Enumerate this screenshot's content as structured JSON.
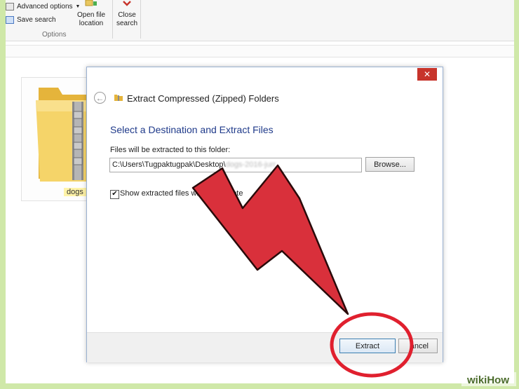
{
  "ribbon": {
    "advanced_options": "Advanced options",
    "save_search": "Save search",
    "group_label": "Options",
    "open_file_location": [
      "Open file",
      "location"
    ],
    "close_search": [
      "Close",
      "search"
    ]
  },
  "folder": {
    "label": "dogs"
  },
  "dialog": {
    "title": "Extract Compressed (Zipped) Folders",
    "close_glyph": "✕",
    "heading": "Select a Destination and Extract Files",
    "path_label": "Files will be extracted to this folder:",
    "path_value": "C:\\Users\\Tugpaktugpak\\Desktop\\",
    "path_blurred": "dogs-2016-jurr",
    "browse_label": "Browse...",
    "show_files_checked": true,
    "show_files_label": "Show extracted files when complete",
    "extract_label": "Extract",
    "cancel_label": "ancel"
  },
  "watermark": "wikiHow",
  "colors": {
    "arrow_red": "#d9303b",
    "highlight_ring": "#e0202e",
    "frame_green": "#cfe8a8"
  },
  "icons": [
    "advanced-options-icon",
    "save-search-icon",
    "open-file-location-icon",
    "close-search-icon",
    "zip-folder-icon",
    "back-arrow-icon",
    "folder-icon",
    "close-icon",
    "checkmark-icon"
  ]
}
